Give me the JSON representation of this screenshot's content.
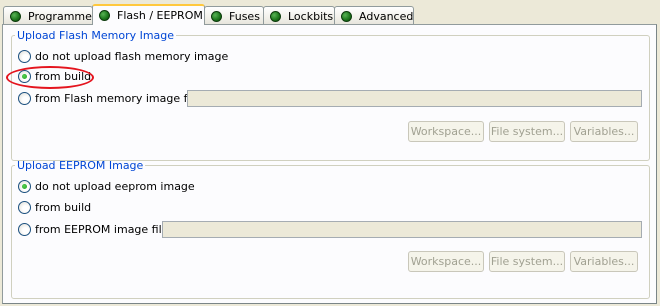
{
  "tabs": [
    {
      "label": "Programmer"
    },
    {
      "label": "Flash / EEPROM",
      "active": true
    },
    {
      "label": "Fuses"
    },
    {
      "label": "Lockbits"
    },
    {
      "label": "Advanced"
    }
  ],
  "flash": {
    "group_title": "Upload Flash Memory Image",
    "options": [
      {
        "label": "do not upload flash memory image",
        "checked": false
      },
      {
        "label": "from build",
        "checked": true
      },
      {
        "label": "from Flash memory image file:",
        "checked": false
      }
    ],
    "file_value": "",
    "buttons": {
      "workspace": "Workspace...",
      "file_system": "File system...",
      "variables": "Variables..."
    }
  },
  "eeprom": {
    "group_title": "Upload EEPROM Image",
    "options": [
      {
        "label": "do not upload eeprom image",
        "checked": true
      },
      {
        "label": "from build",
        "checked": false
      },
      {
        "label": "from EEPROM image file:",
        "checked": false
      }
    ],
    "file_value": "",
    "buttons": {
      "workspace": "Workspace...",
      "file_system": "File system...",
      "variables": "Variables..."
    }
  },
  "annotation": {
    "shape": "ellipse",
    "color": "#e4141e",
    "target": "flash from build"
  },
  "colors": {
    "group_title": "#0046d5",
    "active_tab_top": "#ffc83c",
    "led": "#1f7a1e"
  }
}
